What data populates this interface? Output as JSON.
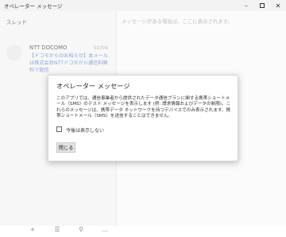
{
  "window": {
    "title": "オペレーター メッセージ"
  },
  "threads": {
    "header": "スレッド",
    "items": [
      {
        "sender": "NTT DOCOMO",
        "date": "02/04",
        "preview": "【ドコモからのお知らせ】本メールは株式会社NTTドコモから通信料無料で配信"
      }
    ]
  },
  "detail": {
    "placeholder": "メッセージがある場合は、ここに表示されます。"
  },
  "bottom_bar": {
    "icons": [
      "add-icon",
      "select-icon",
      "search-icon",
      "more-icon"
    ]
  },
  "dialog": {
    "title": "オペレーター メッセージ",
    "body": "このアプリでは、通信事業者から提供されたデータ通信プランに関する携帯ショートメール（SMS）のテスト メッセージを表示します (例: 請求情報およびデータの制限)。これらのメッセージは、携帯データ ネットワークを持つデバイスでのみ表示されます。携帯ショートメール（SMS）を送信することはできません。",
    "checkbox_label": "今後は表示しない",
    "close_label": "閉じる"
  }
}
